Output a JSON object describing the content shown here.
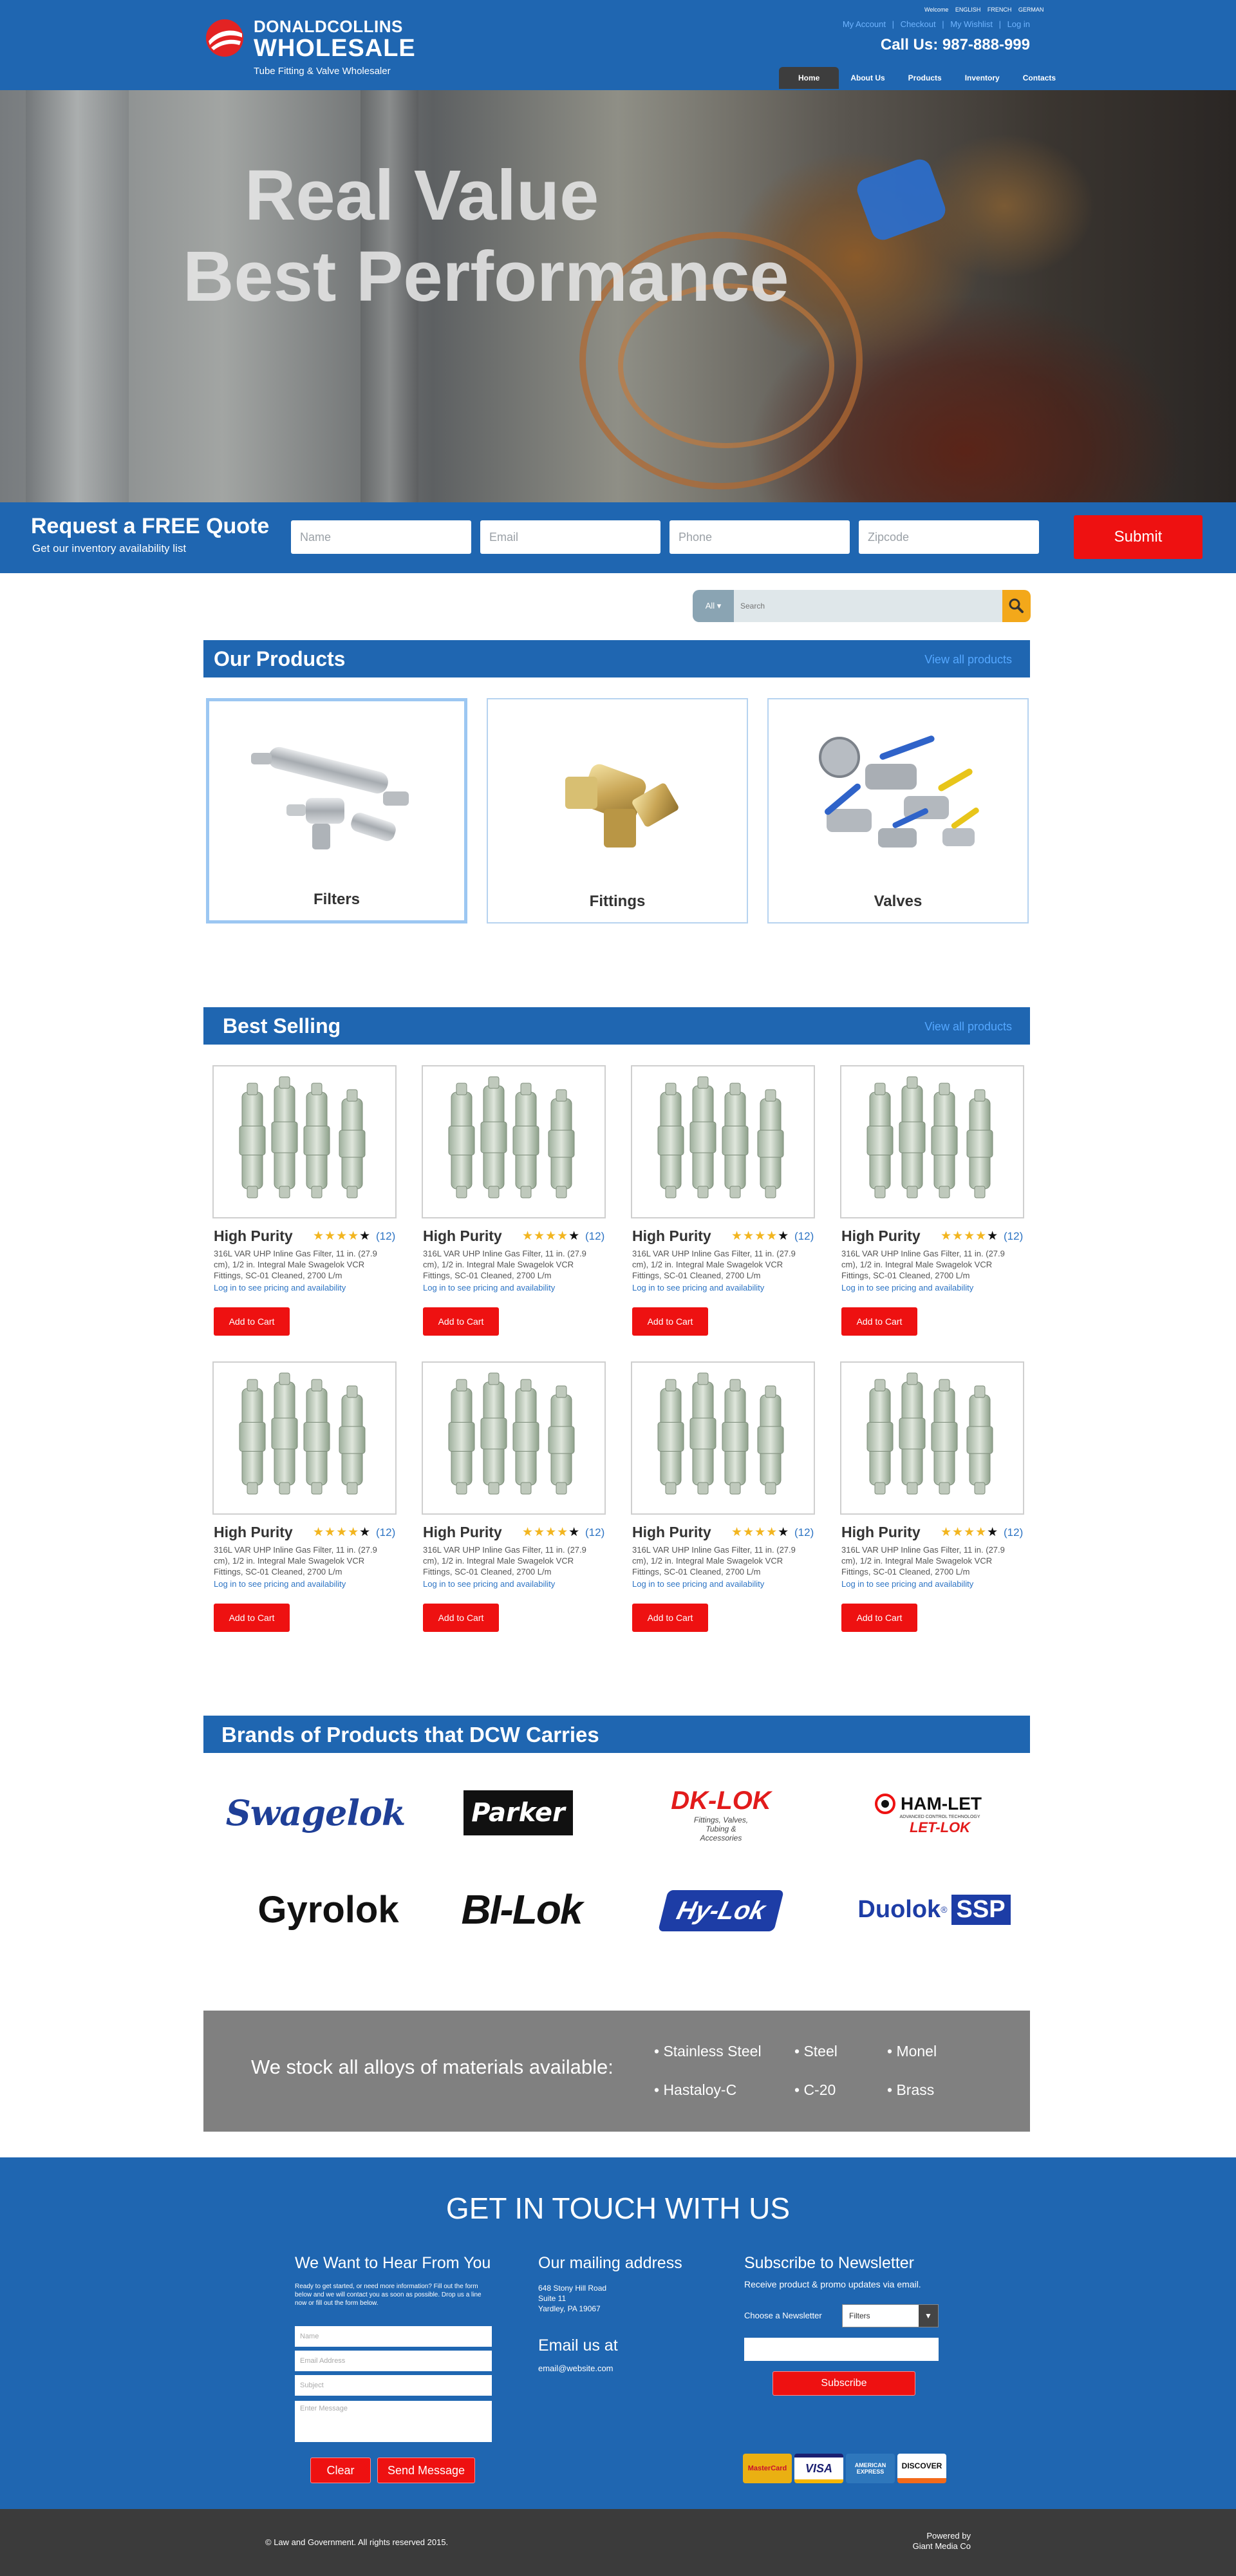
{
  "header": {
    "logo_top": "DONALDCOLLINS",
    "logo_main": "WHOLESALE",
    "logo_sub": "Tube Fitting & Valve Wholesaler",
    "welcome": [
      "Welcome",
      "ENGLISH",
      "FRENCH",
      "GERMAN"
    ],
    "top_links": [
      "My Account",
      "|",
      "Checkout",
      "|",
      "My Wishlist",
      "|",
      "Log in"
    ],
    "call_us": "Call Us: 987-888-999",
    "nav": [
      "Home",
      "About Us",
      "Products",
      "Inventory",
      "Contacts"
    ]
  },
  "hero": {
    "line1": "Real Value",
    "line2": "Best Performance"
  },
  "quote": {
    "title": "Request a FREE Quote",
    "subtitle": "Get our inventory availability list",
    "placeholders": {
      "name": "Name",
      "email": "Email",
      "phone": "Phone",
      "zip": "Zipcode"
    },
    "submit": "Submit"
  },
  "search": {
    "category": "All ▾",
    "placeholder": "Search"
  },
  "products": {
    "title": "Our Products",
    "view_all": "View all products",
    "categories": [
      "Filters",
      "Fittings",
      "Valves"
    ]
  },
  "best_selling": {
    "title": "Best Selling",
    "view_all": "View all products",
    "items": [
      {
        "name": "High Purity",
        "rating": 4,
        "count": "(12)",
        "desc": "316L VAR UHP Inline Gas Filter, 11 in. (27.9 cm), 1/2 in. Integral Male Swagelok VCR Fittings, SC-01 Cleaned, 2700 L/m",
        "login": "Log in to see pricing and availability",
        "cta": "Add to Cart"
      },
      {
        "name": "High Purity",
        "rating": 4,
        "count": "(12)",
        "desc": "316L VAR UHP Inline Gas Filter, 11 in. (27.9 cm), 1/2 in. Integral Male Swagelok VCR Fittings, SC-01 Cleaned, 2700 L/m",
        "login": "Log in to see pricing and availability",
        "cta": "Add to Cart"
      },
      {
        "name": "High Purity",
        "rating": 4,
        "count": "(12)",
        "desc": "316L VAR UHP Inline Gas Filter, 11 in. (27.9 cm), 1/2 in. Integral Male Swagelok VCR Fittings, SC-01 Cleaned, 2700 L/m",
        "login": "Log in to see pricing and availability",
        "cta": "Add to Cart"
      },
      {
        "name": "High Purity",
        "rating": 4,
        "count": "(12)",
        "desc": "316L VAR UHP Inline Gas Filter, 11 in. (27.9 cm), 1/2 in. Integral Male Swagelok VCR Fittings, SC-01 Cleaned, 2700 L/m",
        "login": "Log in to see pricing and availability",
        "cta": "Add to Cart"
      },
      {
        "name": "High Purity",
        "rating": 4,
        "count": "(12)",
        "desc": "316L VAR UHP Inline Gas Filter, 11 in. (27.9 cm), 1/2 in. Integral Male Swagelok VCR Fittings, SC-01 Cleaned, 2700 L/m",
        "login": "Log in to see pricing and availability",
        "cta": "Add to Cart"
      },
      {
        "name": "High Purity",
        "rating": 4,
        "count": "(12)",
        "desc": "316L VAR UHP Inline Gas Filter, 11 in. (27.9 cm), 1/2 in. Integral Male Swagelok VCR Fittings, SC-01 Cleaned, 2700 L/m",
        "login": "Log in to see pricing and availability",
        "cta": "Add to Cart"
      },
      {
        "name": "High Purity",
        "rating": 4,
        "count": "(12)",
        "desc": "316L VAR UHP Inline Gas Filter, 11 in. (27.9 cm), 1/2 in. Integral Male Swagelok VCR Fittings, SC-01 Cleaned, 2700 L/m",
        "login": "Log in to see pricing and availability",
        "cta": "Add to Cart"
      },
      {
        "name": "High Purity",
        "rating": 4,
        "count": "(12)",
        "desc": "316L VAR UHP Inline Gas Filter, 11 in. (27.9 cm), 1/2 in. Integral Male Swagelok VCR Fittings, SC-01 Cleaned, 2700 L/m",
        "login": "Log in to see pricing and availability",
        "cta": "Add to Cart"
      }
    ]
  },
  "brands": {
    "title": "Brands of Products that DCW Carries",
    "logos": {
      "swagelok": "Swagelok",
      "parker": "Parker",
      "dklok": "DK-LOK",
      "dklok_sub": "Fittings, Valves, Tubing & Accessories",
      "hamlet": "HAM-LET",
      "hamlet_sub": "ADVANCED CONTROL TECHNOLOGY",
      "letlok": "LET-LOK",
      "gyrolok": "Gyrolok",
      "bilok": "BI-Lok",
      "hylok": "Hy-Lok",
      "duolok": "Duolok",
      "ssp": "SSP"
    }
  },
  "alloys": {
    "title": "We stock all alloys of materials available:",
    "items": [
      "• Stainless Steel",
      "• Steel",
      "• Monel",
      "• Hastaloy-C",
      "• C-20",
      "• Brass"
    ]
  },
  "contact": {
    "title": "GET IN TOUCH WITH US",
    "hear_title": "We Want to Hear From You",
    "hear_text": "Ready to get started, or need more information? Fill out the form below and we will contact you as soon as possible. Drop us a line now or fill out the form below.",
    "placeholders": {
      "name": "Name",
      "email": "Email Address",
      "subject": "Subject",
      "message": "Enter Message"
    },
    "clear": "Clear",
    "send": "Send Message",
    "mail_title": "Our mailing address",
    "address": [
      "648 Stony Hill Road",
      "Suite 11",
      "Yardley, PA 19067"
    ],
    "email_title": "Email us at",
    "email": "email@website.com",
    "news_title": "Subscribe to Newsletter",
    "news_text": "Receive product & promo updates via email.",
    "choose": "Choose a Newsletter",
    "select_value": "Filters",
    "subscribe": "Subscribe",
    "payments": [
      "MasterCard",
      "VISA",
      "AMERICAN EXPRESS",
      "DISCOVER"
    ]
  },
  "footer": {
    "copyright": "© Law and Government. All rights reserved 2015.",
    "powered1": "Powered by",
    "powered2": "Giant Media Co"
  },
  "colors": {
    "primary": "#1f66b1",
    "accent": "#ee1111",
    "search_btn": "#f3a81a",
    "footer": "#3b3b3b"
  }
}
